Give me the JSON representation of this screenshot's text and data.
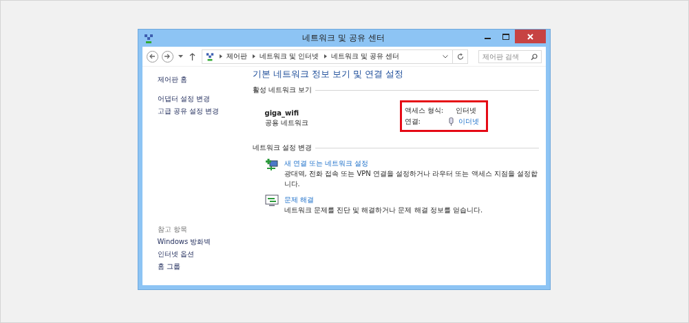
{
  "window": {
    "title": "네트워크 및 공유 센터"
  },
  "address_bar": {
    "breadcrumbs": [
      "제어판",
      "네트워크 및 인터넷",
      "네트워크 및 공유 센터"
    ]
  },
  "search": {
    "placeholder": "제어판 검색"
  },
  "sidebar": {
    "items": [
      "제어판 홈",
      "어댑터 설정 변경",
      "고급 공유 설정 변경"
    ],
    "see_also": {
      "heading": "참고 항목",
      "items": [
        "Windows 방화벽",
        "인터넷 옵션",
        "홈 그룹"
      ]
    }
  },
  "main": {
    "heading": "기본 네트워크 정보 보기 및 연결 설정",
    "active_networks": {
      "heading": "활성 네트워크 보기",
      "name": "giga_wifi",
      "category": "공용 네트워크",
      "access_type_label": "액세스 형식:",
      "access_type": "인터넷",
      "connection_label": "연결:",
      "connection": "이더넷",
      "highlighted": true
    },
    "change_settings": {
      "heading": "네트워크 설정 변경",
      "tasks": [
        {
          "kind": "new-connection",
          "title": "새 연결 또는 네트워크 설정",
          "description": "광대역, 전화 접속 또는 VPN 연결을 설정하거나 라우터 또는 액세스 지점을 설정합니다."
        },
        {
          "kind": "troubleshoot",
          "title": "문제 해결",
          "description": "네트워크 문제를 진단 및 해결하거나 문제 해결 정보를 얻습니다."
        }
      ]
    }
  }
}
